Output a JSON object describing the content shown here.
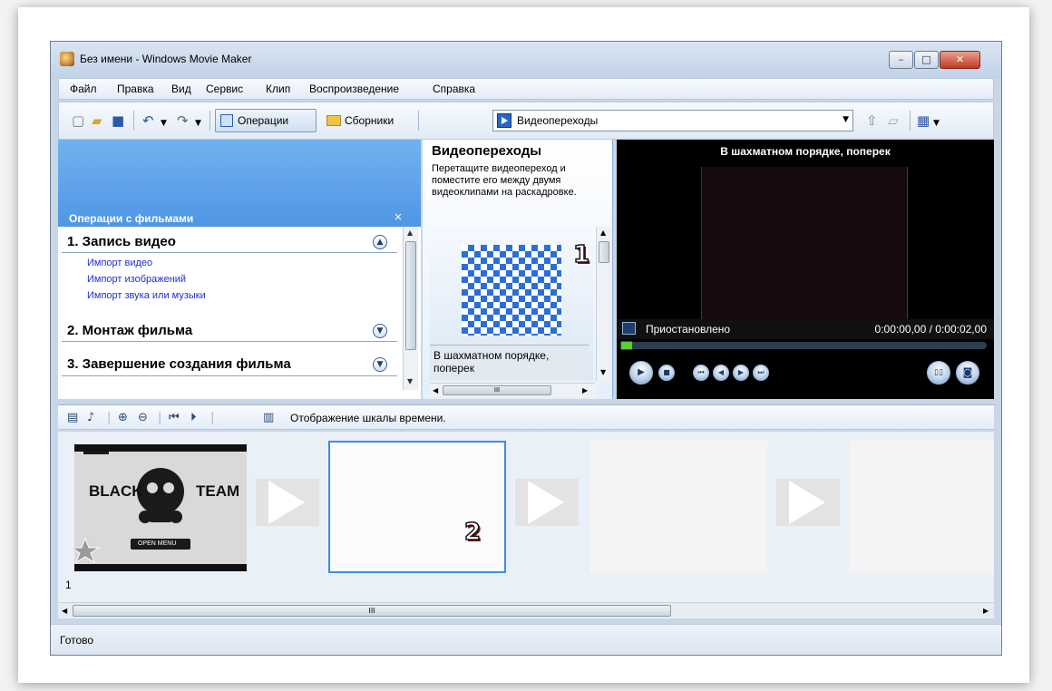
{
  "window": {
    "title": "Без имени - Windows Movie Maker",
    "min_glyph": "–",
    "max_glyph": "□",
    "close_glyph": "✕"
  },
  "menu": [
    "Файл",
    "Правка",
    "Вид",
    "Сервис",
    "Клип",
    "Воспроизведение",
    "Справка"
  ],
  "toolbar": {
    "operations_label": "Операции",
    "collections_label": "Сборники",
    "combo_value": "Видеопереходы"
  },
  "ops_pane": {
    "title": "Операции с фильмами",
    "close_glyph": "×",
    "section1": "1. Запись видео",
    "links": [
      "Импорт видео",
      "Импорт изображений",
      "Импорт звука или музыки"
    ],
    "section2": "2. Монтаж фильма",
    "section3": "3. Завершение создания фильма"
  },
  "transitions": {
    "heading": "Видеопереходы",
    "description": "Перетащите видеопереход и поместите его между двумя видеоклипами на раскадровке.",
    "caption": "В шахматном порядке, поперек",
    "hscroll_label": "III"
  },
  "preview": {
    "title": "В шахматном порядке, поперек",
    "status": "Приостановлено",
    "time": "0:00:00,00 / 0:00:02,00",
    "progress": 0.0
  },
  "timeline_toolbar": {
    "label": "Отображение шкалы времени."
  },
  "storyboard": {
    "clip_text_left": "BLACK",
    "clip_text_right": "TEAM",
    "clip_caption": "OPEN MENU",
    "clip_number": "1",
    "scroll_label": "III"
  },
  "annotations": {
    "one": "1",
    "two": "2"
  },
  "status": "Готово",
  "colors": {
    "accent": "#4f96e4",
    "selection": "#3b8ee8",
    "link": "#1c2fcf",
    "seek": "#5bcf3a"
  }
}
